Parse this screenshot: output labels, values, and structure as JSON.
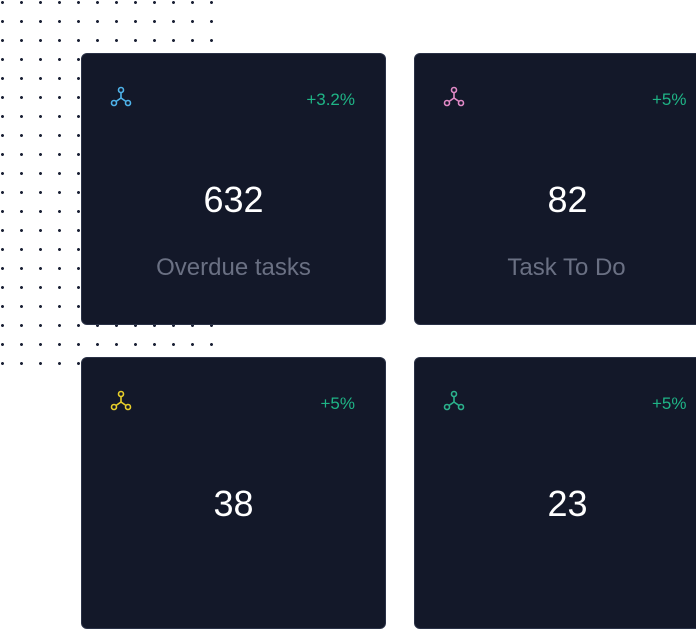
{
  "colors": {
    "background": "#ffffff",
    "card_background": "#131829",
    "delta_positive": "#1fb486",
    "label": "#6a7083",
    "value": "#ffffff",
    "dots": "#1c2236"
  },
  "cards": [
    {
      "icon": "share-nodes-icon",
      "icon_color": "#4fb3ea",
      "delta": "+3.2%",
      "value": "632",
      "label": "Overdue tasks"
    },
    {
      "icon": "share-nodes-icon",
      "icon_color": "#e28ac7",
      "delta": "+5%",
      "value": "82",
      "label": "Task To Do"
    },
    {
      "icon": "share-nodes-icon",
      "icon_color": "#e8cf2a",
      "delta": "+5%",
      "value": "38",
      "label": ""
    },
    {
      "icon": "share-nodes-icon",
      "icon_color": "#2bb38d",
      "delta": "+5%",
      "value": "23",
      "label": ""
    }
  ]
}
